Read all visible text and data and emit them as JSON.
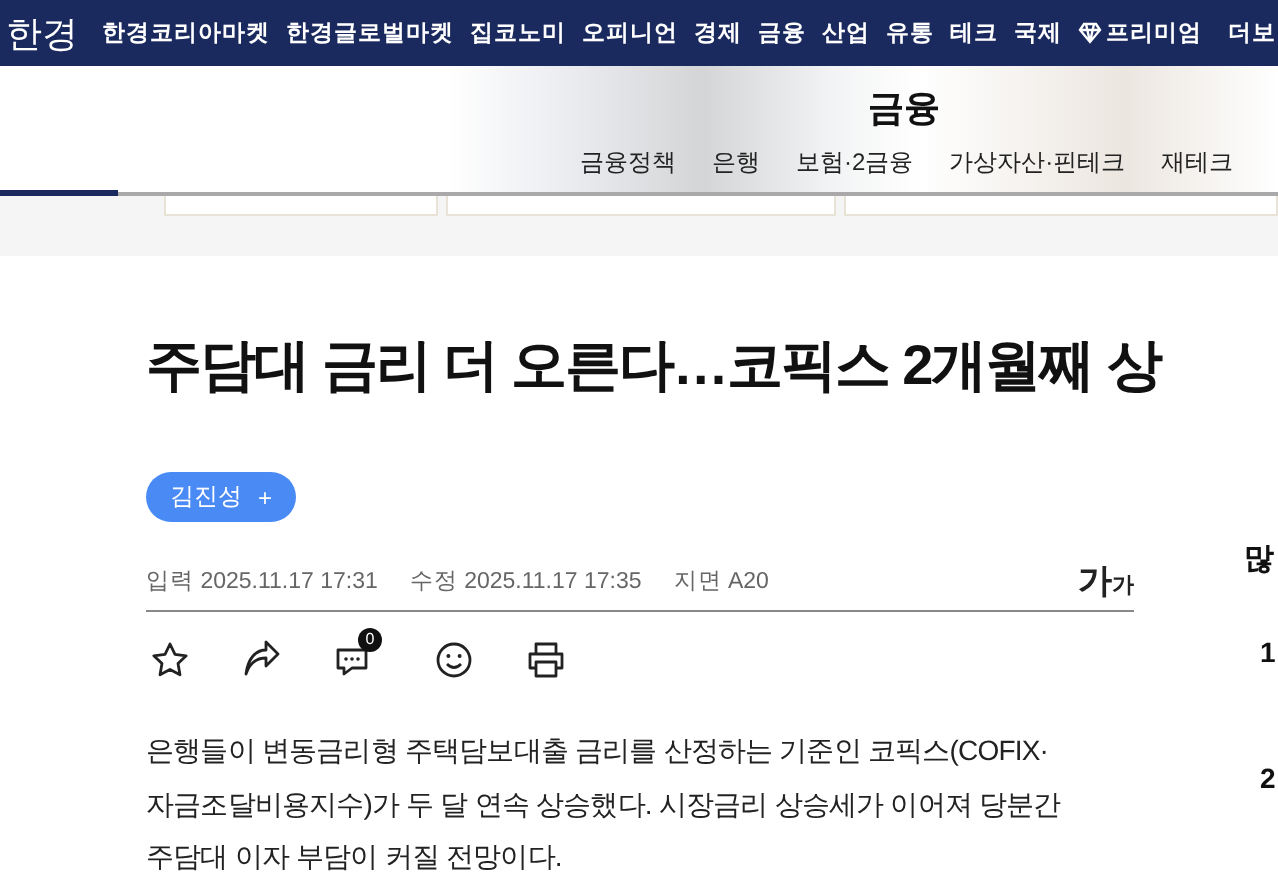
{
  "top_nav": {
    "logo": "한경",
    "items": [
      {
        "label": "한경코리아마켓",
        "kind": "link"
      },
      {
        "label": "한경글로벌마켓",
        "kind": "link"
      },
      {
        "label": "집코노미",
        "kind": "link"
      },
      {
        "label": "오피니언",
        "kind": "link"
      },
      {
        "label": "경제",
        "kind": "link"
      },
      {
        "label": "금융",
        "kind": "link"
      },
      {
        "label": "산업",
        "kind": "link"
      },
      {
        "label": "유통",
        "kind": "link"
      },
      {
        "label": "테크",
        "kind": "link"
      },
      {
        "label": "국제",
        "kind": "link"
      },
      {
        "label": "프리미엄",
        "kind": "premium"
      },
      {
        "label": "더보",
        "kind": "link"
      }
    ]
  },
  "section": {
    "title": "금융",
    "tabs": [
      "금융정책",
      "은행",
      "보험·2금융",
      "가상자산·핀테크",
      "재테크"
    ]
  },
  "article": {
    "headline": "주담대 금리 더 오른다…코픽스 2개월째 상",
    "author": "김진성",
    "author_action": "+",
    "meta": [
      {
        "label": "입력",
        "value": "2025.11.17 17:31"
      },
      {
        "label": "수정",
        "value": "2025.11.17 17:35"
      },
      {
        "label": "지면",
        "value": "A20"
      }
    ],
    "font_size_button": {
      "large": "가",
      "small": "가"
    },
    "comment_count": "0",
    "body": "은행들이 변동금리형 주택담보대출 금리를 산정하는 기준인 코픽스(COFIX·자금조달비용지수)가 두 달 연속 상승했다. 시장금리 상승세가 이어져 당분간 주담대 이자 부담이 커질 전망이다."
  },
  "sidebar": {
    "heading": "많",
    "ranks": [
      "1",
      "2"
    ]
  }
}
